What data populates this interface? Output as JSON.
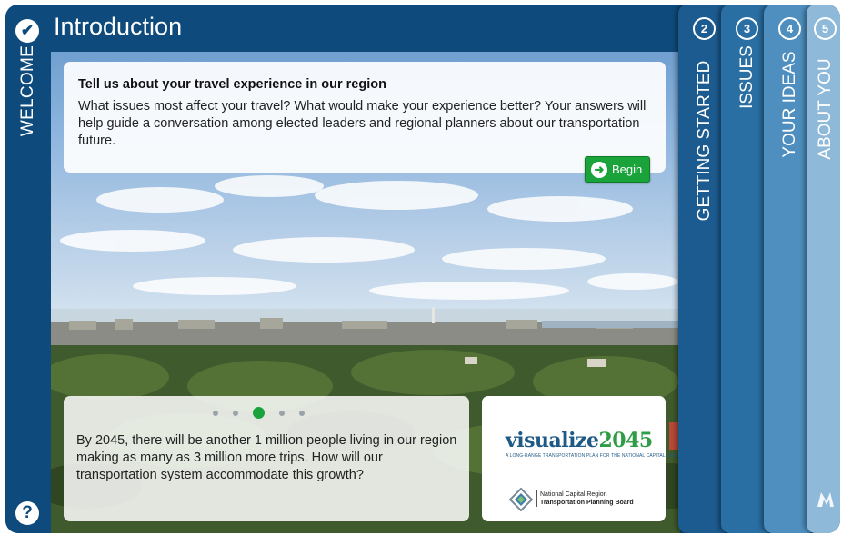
{
  "header": {
    "title": "Introduction",
    "check_icon": "check-circle-icon"
  },
  "left_rail": {
    "label": "WELCOME",
    "help_symbol": "?"
  },
  "intro": {
    "heading": "Tell us about your travel experience in our region",
    "text": "What issues most affect your travel? What would make your experience better? Your answers will help guide a conversation among elected leaders and regional planners about our transportation future.",
    "begin_label": "Begin"
  },
  "carousel": {
    "slide_count": 5,
    "active_index": 3,
    "text": "By 2045, there will be another 1 million people living in our region making as many as 3 million more trips. How will our transportation system accommodate this growth?"
  },
  "logo": {
    "name_part1": "visualize",
    "name_part2": "2045",
    "tagline": "A LONG-RANGE TRANSPORTATION PLAN FOR THE NATIONAL CAPITAL REGION",
    "org_line1": "National Capital Region",
    "org_line2": "Transportation Planning Board"
  },
  "tabs": [
    {
      "number": "2",
      "label": "GETTING STARTED"
    },
    {
      "number": "3",
      "label": "ISSUES"
    },
    {
      "number": "4",
      "label": "YOUR IDEAS"
    },
    {
      "number": "5",
      "label": "ABOUT YOU"
    }
  ],
  "colors": {
    "primary_blue": "#0e4b7c",
    "accent_green": "#19a33a",
    "tab2": "#1c5b8f",
    "tab3": "#2a6fa3",
    "tab4": "#4f8fbf",
    "tab5": "#8fb9d9"
  }
}
